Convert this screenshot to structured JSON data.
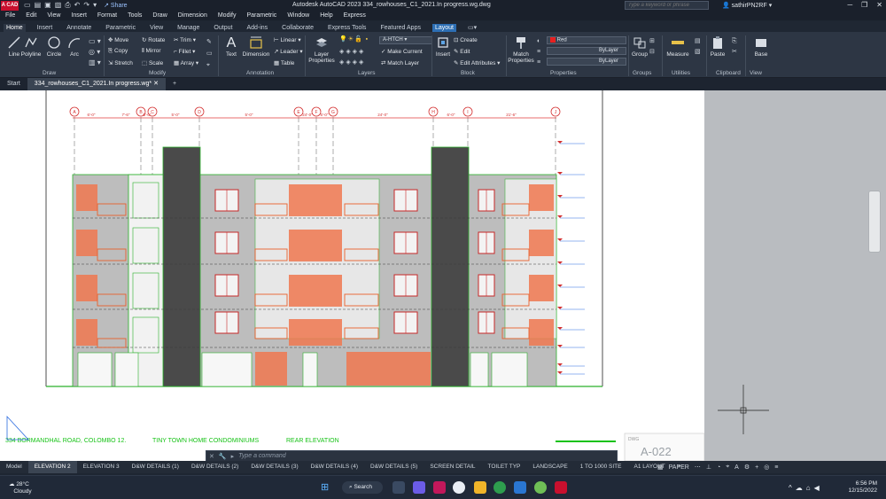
{
  "app": {
    "logo": "A CAD",
    "share_label": "Share",
    "window_title": "Autodesk AutoCAD 2023   334_rowhouses_C1_2021.In progress.wg.dwg",
    "search_placeholder": "Type a keyword or phrase",
    "user": "sathirPN2RF"
  },
  "menus": [
    "File",
    "Edit",
    "View",
    "Insert",
    "Format",
    "Tools",
    "Draw",
    "Dimension",
    "Modify",
    "Parametric",
    "Window",
    "Help",
    "Express"
  ],
  "ribbon_tabs": [
    "Home",
    "Insert",
    "Annotate",
    "Parametric",
    "View",
    "Manage",
    "Output",
    "Add-ins",
    "Collaborate",
    "Express Tools",
    "Featured Apps",
    "Layout"
  ],
  "ribbon": {
    "draw": {
      "line": "Line",
      "polyline": "Polyline",
      "circle": "Circle",
      "arc": "Arc",
      "title": "Draw"
    },
    "modify": {
      "move": "Move",
      "rotate": "Rotate",
      "trim": "Trim",
      "copy": "Copy",
      "mirror": "Mirror",
      "fillet": "Fillet",
      "stretch": "Stretch",
      "scale": "Scale",
      "array": "Array",
      "title": "Modify"
    },
    "annotation": {
      "text": "Text",
      "dimension": "Dimension",
      "linear": "Linear",
      "leader": "Leader",
      "table": "Table",
      "title": "Annotation"
    },
    "layers": {
      "layer_properties": "Layer Properties",
      "current_layer": "A-HTCH",
      "make_current": "Make Current",
      "match_layer": "Match Layer",
      "title": "Layers"
    },
    "block": {
      "insert": "Insert",
      "create": "Create",
      "edit": "Edit",
      "edit_attributes": "Edit Attributes",
      "title": "Block"
    },
    "properties": {
      "match": "Match Properties",
      "color": "Red",
      "linetype": "ByLayer",
      "lineweight": "ByLayer",
      "plot": "ByLayer",
      "title": "Properties"
    },
    "groups": {
      "group": "Group",
      "title": "Groups"
    },
    "utilities": {
      "measure": "Measure",
      "title": "Utilities"
    },
    "clipboard": {
      "paste": "Paste",
      "title": "Clipboard"
    },
    "view": {
      "base": "Base",
      "title": "View"
    }
  },
  "doc_tabs": {
    "start": "Start",
    "file": "334_rowhouses_C1_2021.In progress.wg*"
  },
  "drawing": {
    "grid_labels": [
      "A",
      "B",
      "C",
      "D",
      "E",
      "F",
      "G",
      "H",
      "I",
      "J",
      "K"
    ],
    "dims": [
      "6'-0\"",
      "7'-6\"",
      "5'-0\"",
      "5'-0\"",
      "5'-0\"",
      "24'-0\"",
      "5'-0\"",
      "24'-0\"",
      "6'-0\"",
      "21'-6\""
    ],
    "caption_address": "334 BORMANDHAL ROAD, COLOMBO 12.",
    "caption_project": "TINY TOWN HOME CONDOMINIUMS",
    "caption_view": "REAR ELEVATION",
    "sheet_label": "DWG",
    "sheet_no": "A-022"
  },
  "command": {
    "placeholder": "Type a command"
  },
  "layout_tabs": [
    "Model",
    "ELEVATION 2",
    "ELEVATION 3",
    "D&W DETAILS (1)",
    "D&W DETAILS (2)",
    "D&W DETAILS (3)",
    "D&W DETAILS (4)",
    "D&W DETAILS (5)",
    "SCREEN DETAIL",
    "TOILET TYP",
    "LANDSCAPE",
    "1 TO 1000 SITE",
    "A1 LAYOUT"
  ],
  "status": {
    "paper": "PAPER"
  },
  "taskbar": {
    "temp": "28°C",
    "condition": "Cloudy",
    "search": "Search",
    "time": "6:56 PM",
    "date": "12/15/2022"
  }
}
